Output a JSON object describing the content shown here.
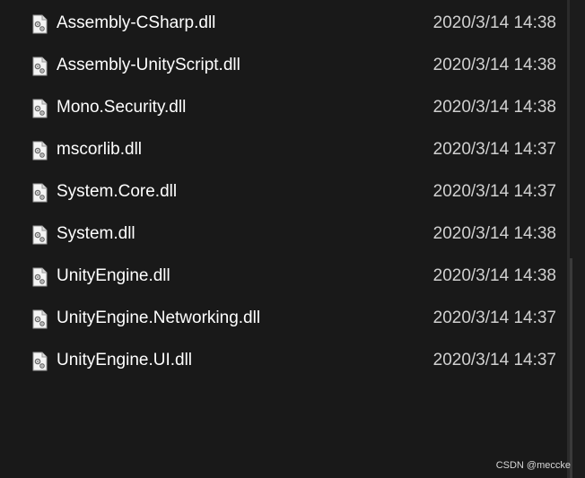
{
  "files": [
    {
      "name": "Assembly-CSharp.dll",
      "modified": "2020/3/14 14:38",
      "icon": "dll-file-icon"
    },
    {
      "name": "Assembly-UnityScript.dll",
      "modified": "2020/3/14 14:38",
      "icon": "dll-file-icon"
    },
    {
      "name": "Mono.Security.dll",
      "modified": "2020/3/14 14:38",
      "icon": "dll-file-icon"
    },
    {
      "name": "mscorlib.dll",
      "modified": "2020/3/14 14:37",
      "icon": "dll-file-icon"
    },
    {
      "name": "System.Core.dll",
      "modified": "2020/3/14 14:37",
      "icon": "dll-file-icon"
    },
    {
      "name": "System.dll",
      "modified": "2020/3/14 14:38",
      "icon": "dll-file-icon"
    },
    {
      "name": "UnityEngine.dll",
      "modified": "2020/3/14 14:38",
      "icon": "dll-file-icon"
    },
    {
      "name": "UnityEngine.Networking.dll",
      "modified": "2020/3/14 14:37",
      "icon": "dll-file-icon"
    },
    {
      "name": "UnityEngine.UI.dll",
      "modified": "2020/3/14 14:37",
      "icon": "dll-file-icon"
    }
  ],
  "watermark": "CSDN @meccke",
  "colors": {
    "background": "#191919",
    "text": "#ffffff",
    "date_text": "#d0d0d0"
  }
}
